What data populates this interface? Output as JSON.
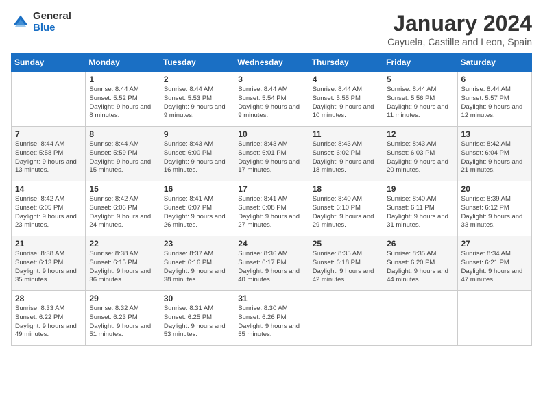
{
  "header": {
    "logo_general": "General",
    "logo_blue": "Blue",
    "month_title": "January 2024",
    "subtitle": "Cayuela, Castille and Leon, Spain"
  },
  "days_of_week": [
    "Sunday",
    "Monday",
    "Tuesday",
    "Wednesday",
    "Thursday",
    "Friday",
    "Saturday"
  ],
  "weeks": [
    [
      {
        "day": "",
        "sunrise": "",
        "sunset": "",
        "daylight": ""
      },
      {
        "day": "1",
        "sunrise": "Sunrise: 8:44 AM",
        "sunset": "Sunset: 5:52 PM",
        "daylight": "Daylight: 9 hours and 8 minutes."
      },
      {
        "day": "2",
        "sunrise": "Sunrise: 8:44 AM",
        "sunset": "Sunset: 5:53 PM",
        "daylight": "Daylight: 9 hours and 9 minutes."
      },
      {
        "day": "3",
        "sunrise": "Sunrise: 8:44 AM",
        "sunset": "Sunset: 5:54 PM",
        "daylight": "Daylight: 9 hours and 9 minutes."
      },
      {
        "day": "4",
        "sunrise": "Sunrise: 8:44 AM",
        "sunset": "Sunset: 5:55 PM",
        "daylight": "Daylight: 9 hours and 10 minutes."
      },
      {
        "day": "5",
        "sunrise": "Sunrise: 8:44 AM",
        "sunset": "Sunset: 5:56 PM",
        "daylight": "Daylight: 9 hours and 11 minutes."
      },
      {
        "day": "6",
        "sunrise": "Sunrise: 8:44 AM",
        "sunset": "Sunset: 5:57 PM",
        "daylight": "Daylight: 9 hours and 12 minutes."
      }
    ],
    [
      {
        "day": "7",
        "sunrise": "Sunrise: 8:44 AM",
        "sunset": "Sunset: 5:58 PM",
        "daylight": "Daylight: 9 hours and 13 minutes."
      },
      {
        "day": "8",
        "sunrise": "Sunrise: 8:44 AM",
        "sunset": "Sunset: 5:59 PM",
        "daylight": "Daylight: 9 hours and 15 minutes."
      },
      {
        "day": "9",
        "sunrise": "Sunrise: 8:43 AM",
        "sunset": "Sunset: 6:00 PM",
        "daylight": "Daylight: 9 hours and 16 minutes."
      },
      {
        "day": "10",
        "sunrise": "Sunrise: 8:43 AM",
        "sunset": "Sunset: 6:01 PM",
        "daylight": "Daylight: 9 hours and 17 minutes."
      },
      {
        "day": "11",
        "sunrise": "Sunrise: 8:43 AM",
        "sunset": "Sunset: 6:02 PM",
        "daylight": "Daylight: 9 hours and 18 minutes."
      },
      {
        "day": "12",
        "sunrise": "Sunrise: 8:43 AM",
        "sunset": "Sunset: 6:03 PM",
        "daylight": "Daylight: 9 hours and 20 minutes."
      },
      {
        "day": "13",
        "sunrise": "Sunrise: 8:42 AM",
        "sunset": "Sunset: 6:04 PM",
        "daylight": "Daylight: 9 hours and 21 minutes."
      }
    ],
    [
      {
        "day": "14",
        "sunrise": "Sunrise: 8:42 AM",
        "sunset": "Sunset: 6:05 PM",
        "daylight": "Daylight: 9 hours and 23 minutes."
      },
      {
        "day": "15",
        "sunrise": "Sunrise: 8:42 AM",
        "sunset": "Sunset: 6:06 PM",
        "daylight": "Daylight: 9 hours and 24 minutes."
      },
      {
        "day": "16",
        "sunrise": "Sunrise: 8:41 AM",
        "sunset": "Sunset: 6:07 PM",
        "daylight": "Daylight: 9 hours and 26 minutes."
      },
      {
        "day": "17",
        "sunrise": "Sunrise: 8:41 AM",
        "sunset": "Sunset: 6:08 PM",
        "daylight": "Daylight: 9 hours and 27 minutes."
      },
      {
        "day": "18",
        "sunrise": "Sunrise: 8:40 AM",
        "sunset": "Sunset: 6:10 PM",
        "daylight": "Daylight: 9 hours and 29 minutes."
      },
      {
        "day": "19",
        "sunrise": "Sunrise: 8:40 AM",
        "sunset": "Sunset: 6:11 PM",
        "daylight": "Daylight: 9 hours and 31 minutes."
      },
      {
        "day": "20",
        "sunrise": "Sunrise: 8:39 AM",
        "sunset": "Sunset: 6:12 PM",
        "daylight": "Daylight: 9 hours and 33 minutes."
      }
    ],
    [
      {
        "day": "21",
        "sunrise": "Sunrise: 8:38 AM",
        "sunset": "Sunset: 6:13 PM",
        "daylight": "Daylight: 9 hours and 35 minutes."
      },
      {
        "day": "22",
        "sunrise": "Sunrise: 8:38 AM",
        "sunset": "Sunset: 6:15 PM",
        "daylight": "Daylight: 9 hours and 36 minutes."
      },
      {
        "day": "23",
        "sunrise": "Sunrise: 8:37 AM",
        "sunset": "Sunset: 6:16 PM",
        "daylight": "Daylight: 9 hours and 38 minutes."
      },
      {
        "day": "24",
        "sunrise": "Sunrise: 8:36 AM",
        "sunset": "Sunset: 6:17 PM",
        "daylight": "Daylight: 9 hours and 40 minutes."
      },
      {
        "day": "25",
        "sunrise": "Sunrise: 8:35 AM",
        "sunset": "Sunset: 6:18 PM",
        "daylight": "Daylight: 9 hours and 42 minutes."
      },
      {
        "day": "26",
        "sunrise": "Sunrise: 8:35 AM",
        "sunset": "Sunset: 6:20 PM",
        "daylight": "Daylight: 9 hours and 44 minutes."
      },
      {
        "day": "27",
        "sunrise": "Sunrise: 8:34 AM",
        "sunset": "Sunset: 6:21 PM",
        "daylight": "Daylight: 9 hours and 47 minutes."
      }
    ],
    [
      {
        "day": "28",
        "sunrise": "Sunrise: 8:33 AM",
        "sunset": "Sunset: 6:22 PM",
        "daylight": "Daylight: 9 hours and 49 minutes."
      },
      {
        "day": "29",
        "sunrise": "Sunrise: 8:32 AM",
        "sunset": "Sunset: 6:23 PM",
        "daylight": "Daylight: 9 hours and 51 minutes."
      },
      {
        "day": "30",
        "sunrise": "Sunrise: 8:31 AM",
        "sunset": "Sunset: 6:25 PM",
        "daylight": "Daylight: 9 hours and 53 minutes."
      },
      {
        "day": "31",
        "sunrise": "Sunrise: 8:30 AM",
        "sunset": "Sunset: 6:26 PM",
        "daylight": "Daylight: 9 hours and 55 minutes."
      },
      {
        "day": "",
        "sunrise": "",
        "sunset": "",
        "daylight": ""
      },
      {
        "day": "",
        "sunrise": "",
        "sunset": "",
        "daylight": ""
      },
      {
        "day": "",
        "sunrise": "",
        "sunset": "",
        "daylight": ""
      }
    ]
  ]
}
